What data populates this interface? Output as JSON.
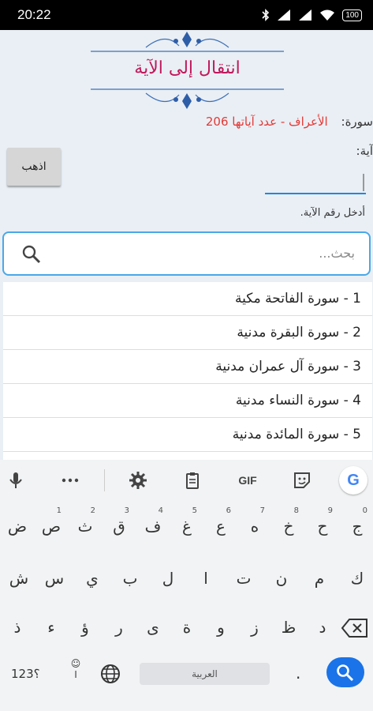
{
  "status": {
    "time": "20:22",
    "battery": "100"
  },
  "dialog": {
    "title": "انتقال إلى الآية",
    "surah_label": "سورة:",
    "surah_value": "الأعراف - عدد آياتها 206",
    "aya_label": "آية:",
    "go_label": "اذهب",
    "hint": "أدخل رقم الآية."
  },
  "search": {
    "placeholder": "بحث..."
  },
  "surahs": [
    "1 - سورة الفاتحة مكية",
    "2 - سورة البقرة مدنية",
    "3 - سورة آل عمران مدنية",
    "4 - سورة النساء مدنية",
    "5 - سورة المائدة مدنية"
  ],
  "keyboard": {
    "toolbar": {
      "gif": "GIF",
      "google": "G"
    },
    "row1": [
      {
        "char": "ج",
        "sup": "0"
      },
      {
        "char": "ح",
        "sup": "9"
      },
      {
        "char": "خ",
        "sup": "8"
      },
      {
        "char": "ه",
        "sup": "7"
      },
      {
        "char": "ع",
        "sup": "6"
      },
      {
        "char": "غ",
        "sup": "5"
      },
      {
        "char": "ف",
        "sup": "4"
      },
      {
        "char": "ق",
        "sup": "3"
      },
      {
        "char": "ث",
        "sup": "2"
      },
      {
        "char": "ص",
        "sup": "1"
      },
      {
        "char": "ض",
        "sup": ""
      }
    ],
    "row2": [
      "ك",
      "م",
      "ن",
      "ت",
      "ا",
      "ل",
      "ب",
      "ي",
      "س",
      "ش"
    ],
    "row3": [
      "د",
      "ظ",
      "ز",
      "و",
      "ة",
      "ى",
      "ر",
      "ؤ",
      "ء",
      "ذ"
    ],
    "bottom": {
      "symbols": "؟123",
      "punct_hint": "ا",
      "space": "العربية",
      "period": "."
    }
  },
  "colors": {
    "title": "#c2185b",
    "surah_value": "#e53935",
    "accent": "#1a73e8"
  }
}
